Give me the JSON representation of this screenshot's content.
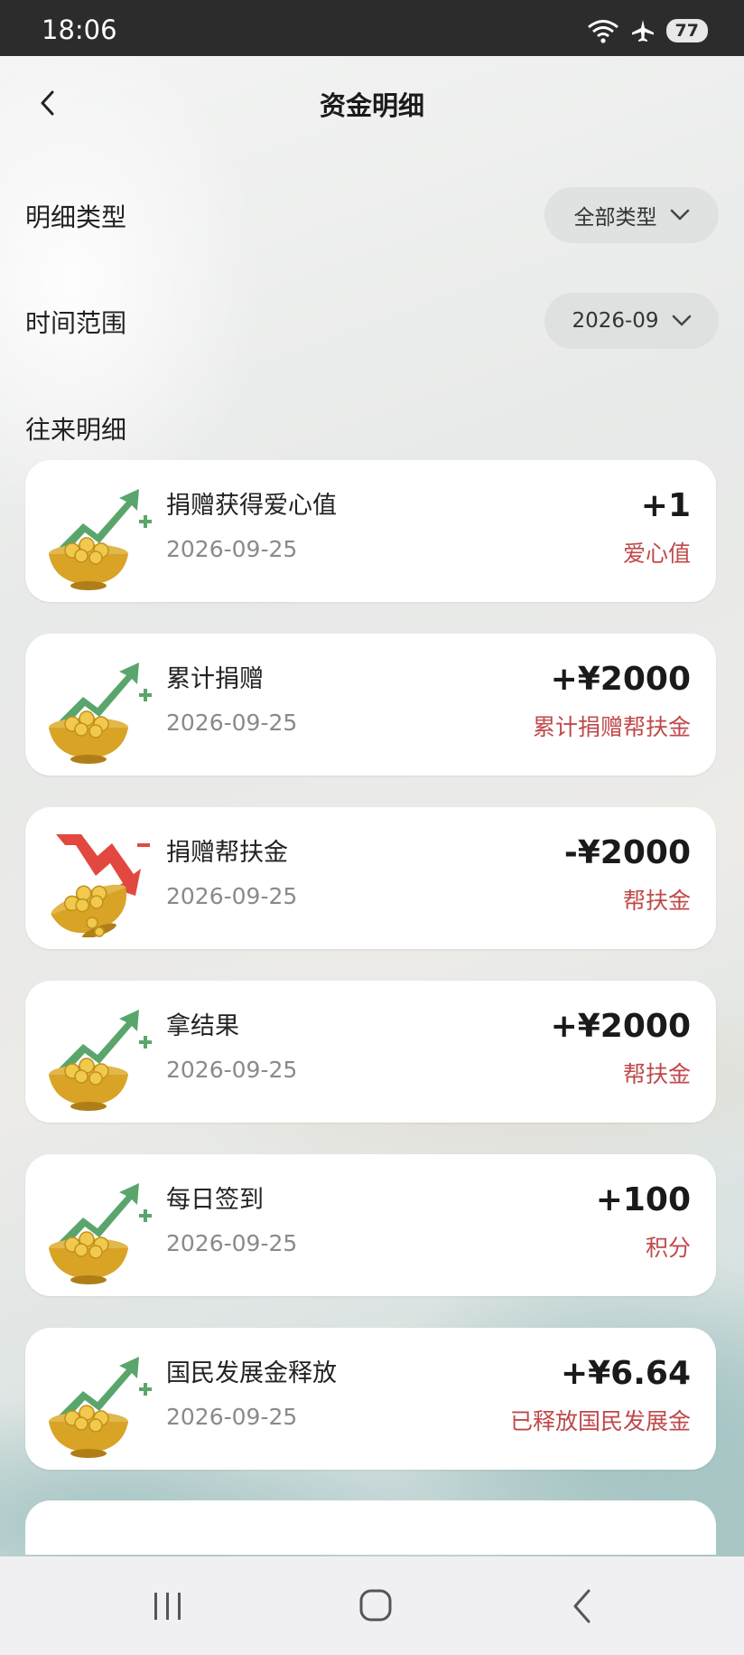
{
  "status_bar": {
    "time": "18:06",
    "battery": "77"
  },
  "header": {
    "title": "资金明细"
  },
  "filters": {
    "type_label": "明细类型",
    "type_value": "全部类型",
    "time_label": "时间范围",
    "time_value": "2026-09"
  },
  "section_title": "往来明细",
  "records": [
    {
      "title": "捐赠获得爱心值",
      "date": "2026-09-25",
      "amount": "+1",
      "note": "爱心值",
      "direction": "up"
    },
    {
      "title": "累计捐赠",
      "date": "2026-09-25",
      "amount": "+¥2000",
      "note": "累计捐赠帮扶金",
      "direction": "up"
    },
    {
      "title": "捐赠帮扶金",
      "date": "2026-09-25",
      "amount": "-¥2000",
      "note": "帮扶金",
      "direction": "down"
    },
    {
      "title": "拿结果",
      "date": "2026-09-25",
      "amount": "+¥2000",
      "note": "帮扶金",
      "direction": "up"
    },
    {
      "title": "每日签到",
      "date": "2026-09-25",
      "amount": "+100",
      "note": "积分",
      "direction": "up"
    },
    {
      "title": "国民发展金释放",
      "date": "2026-09-25",
      "amount": "+¥6.64",
      "note": "已释放国民发展金",
      "direction": "up"
    }
  ],
  "colors": {
    "note_red": "#c0484a",
    "arrow_green": "#5aa56c",
    "arrow_red": "#e2483f",
    "gold": "#d9a326"
  },
  "icons": {
    "up": "gold-bowl-up-arrow-icon",
    "down": "gold-bowl-down-arrow-icon"
  }
}
